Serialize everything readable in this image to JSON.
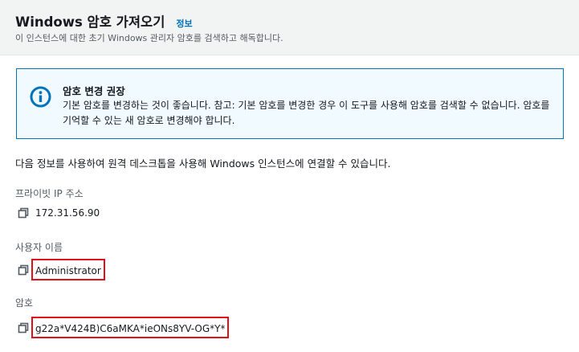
{
  "header": {
    "title": "Windows 암호 가져오기",
    "info_link": "정보",
    "subtitle": "이 인스턴스에 대한 초기 Windows 관리자 암호를 검색하고 해독합니다."
  },
  "alert": {
    "title": "암호 변경 권장",
    "body": "기본 암호를 변경하는 것이 좋습니다. 참고: 기본 암호를 변경한 경우 이 도구를 사용해 암호를 검색할 수 없습니다. 암호를 기억할 수 있는 새 암호로 변경해야 합니다.",
    "icon": "info-icon",
    "accent_color": "#0073bb"
  },
  "description": "다음 정보를 사용하여 원격 데스크톱을 사용해 Windows 인스턴스에 연결할 수 있습니다.",
  "fields": [
    {
      "label": "프라이빗 IP 주소",
      "value": "172.31.56.90",
      "icon": "copy-icon"
    },
    {
      "label": "사용자 이름",
      "value": "Administrator",
      "icon": "copy-icon"
    },
    {
      "label": "암호",
      "value": "g22a*V424B)C6aMKA*ieONs8YV-OG*Y*",
      "icon": "copy-icon"
    }
  ],
  "highlight_color": "#e0101a"
}
